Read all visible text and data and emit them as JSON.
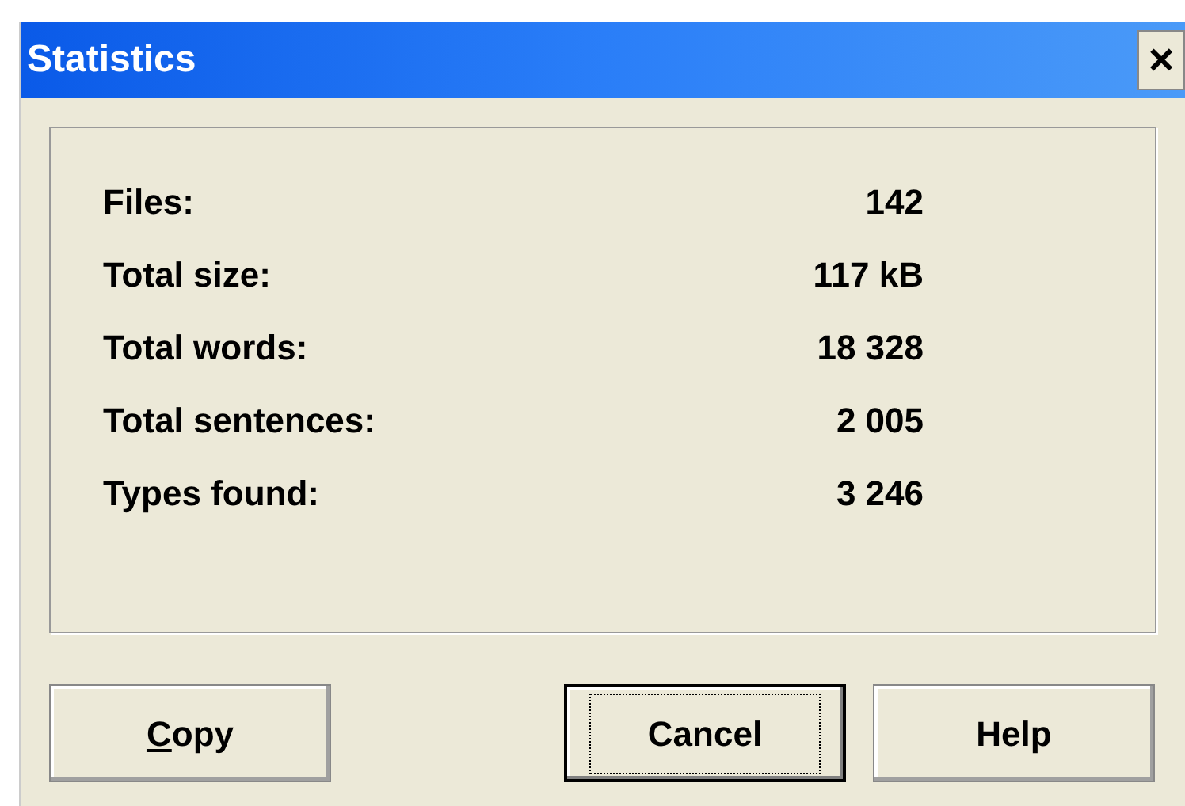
{
  "window": {
    "title": "Statistics",
    "close": "×"
  },
  "stats": [
    {
      "label": "Files:",
      "value": "142"
    },
    {
      "label": "Total size:",
      "value": "117 kB"
    },
    {
      "label": "Total words:",
      "value": "18 328"
    },
    {
      "label": "Total sentences:",
      "value": "2 005"
    },
    {
      "label": "Types found:",
      "value": "3 246"
    }
  ],
  "buttons": [
    {
      "label": "Copy",
      "mnemonic_underlined": true,
      "focused": false
    },
    {
      "label": "Cancel",
      "mnemonic_underlined": false,
      "focused": true
    },
    {
      "label": "Help",
      "mnemonic_underlined": false,
      "focused": false
    }
  ]
}
